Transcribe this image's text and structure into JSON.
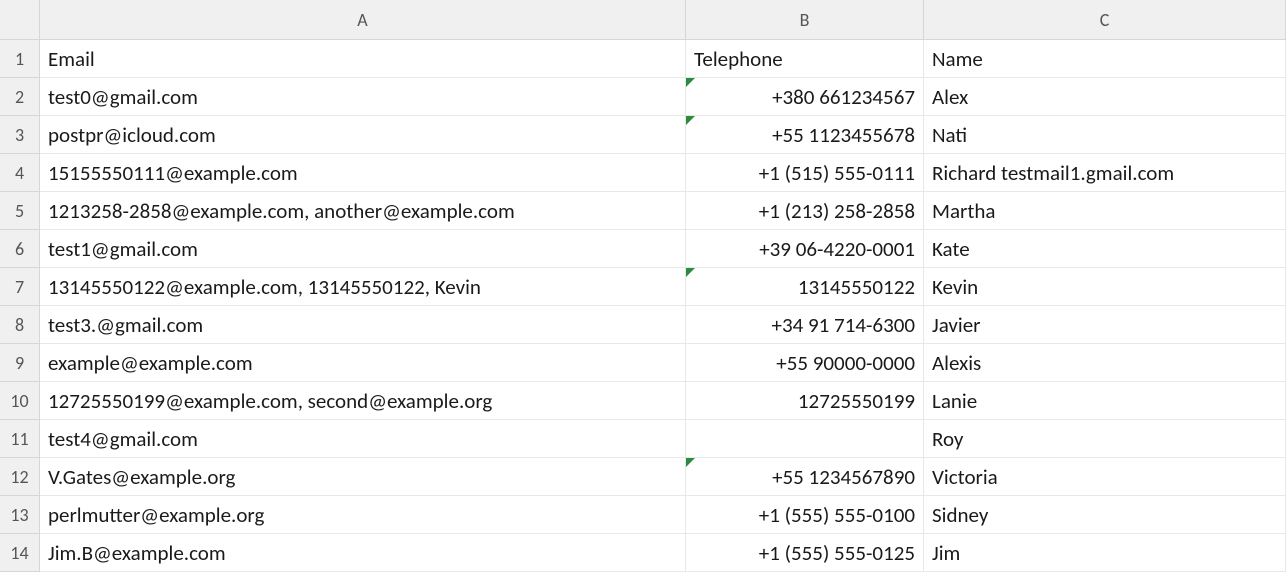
{
  "columns": [
    "A",
    "B",
    "C"
  ],
  "headers": {
    "A": "Email",
    "B": "Telephone",
    "C": "Name"
  },
  "rows": [
    {
      "n": 1,
      "A": "Email",
      "B": "Telephone",
      "C": "Name",
      "Berr": false,
      "Bright": false
    },
    {
      "n": 2,
      "A": "test0@gmail.com",
      "B": "+380 661234567",
      "C": "Alex",
      "Berr": true,
      "Bright": true
    },
    {
      "n": 3,
      "A": "postpr@icloud.com",
      "B": "+55 1123455678",
      "C": "Nati",
      "Berr": true,
      "Bright": true
    },
    {
      "n": 4,
      "A": "15155550111@example.com",
      "B": "+1 (515) 555-0111",
      "C": "Richard testmail1.gmail.com",
      "Berr": false,
      "Bright": true
    },
    {
      "n": 5,
      "A": "1213258-2858@example.com, another@example.com",
      "B": "+1 (213) 258-2858",
      "C": "Martha",
      "Berr": false,
      "Bright": true
    },
    {
      "n": 6,
      "A": "test1@gmail.com",
      "B": "+39 06-4220-0001",
      "C": "Kate",
      "Berr": false,
      "Bright": true
    },
    {
      "n": 7,
      "A": "13145550122@example.com, 13145550122, Kevin",
      "B": "13145550122",
      "C": "Kevin",
      "Berr": true,
      "Bright": true
    },
    {
      "n": 8,
      "A": "test3.@gmail.com",
      "B": "+34 91 714-6300",
      "C": "Javier",
      "Berr": false,
      "Bright": true
    },
    {
      "n": 9,
      "A": "example@example.com",
      "B": "+55 90000-0000",
      "C": "Alexis",
      "Berr": false,
      "Bright": true
    },
    {
      "n": 10,
      "A": "12725550199@example.com, second@example.org",
      "B": "12725550199",
      "C": "Lanie",
      "Berr": false,
      "Bright": true
    },
    {
      "n": 11,
      "A": "test4@gmail.com",
      "B": "",
      "C": "Roy",
      "Berr": false,
      "Bright": true
    },
    {
      "n": 12,
      "A": "V.Gates@example.org",
      "B": "+55 1234567890",
      "C": "Victoria",
      "Berr": true,
      "Bright": true
    },
    {
      "n": 13,
      "A": "perlmutter@example.org",
      "B": "+1 (555) 555-0100",
      "C": "Sidney",
      "Berr": false,
      "Bright": true
    },
    {
      "n": 14,
      "A": "Jim.B@example.com",
      "B": "+1 (555) 555-0125",
      "C": "Jim",
      "Berr": false,
      "Bright": true
    }
  ],
  "chart_data": {
    "type": "table",
    "columns": [
      "Email",
      "Telephone",
      "Name"
    ],
    "data": [
      [
        "test0@gmail.com",
        "+380 661234567",
        "Alex"
      ],
      [
        "postpr@icloud.com",
        "+55 1123455678",
        "Nati"
      ],
      [
        "15155550111@example.com",
        "+1 (515) 555-0111",
        "Richard testmail1.gmail.com"
      ],
      [
        "1213258-2858@example.com, another@example.com",
        "+1 (213) 258-2858",
        "Martha"
      ],
      [
        "test1@gmail.com",
        "+39 06-4220-0001",
        "Kate"
      ],
      [
        "13145550122@example.com, 13145550122, Kevin",
        "13145550122",
        "Kevin"
      ],
      [
        "test3.@gmail.com",
        "+34 91 714-6300",
        "Javier"
      ],
      [
        "example@example.com",
        "+55 90000-0000",
        "Alexis"
      ],
      [
        "12725550199@example.com, second@example.org",
        "12725550199",
        "Lanie"
      ],
      [
        "test4@gmail.com",
        "",
        "Roy"
      ],
      [
        "V.Gates@example.org",
        "+55 1234567890",
        "Victoria"
      ],
      [
        "perlmutter@example.org",
        "+1 (555) 555-0100",
        "Sidney"
      ],
      [
        "Jim.B@example.com",
        "+1 (555) 555-0125",
        "Jim"
      ]
    ]
  }
}
